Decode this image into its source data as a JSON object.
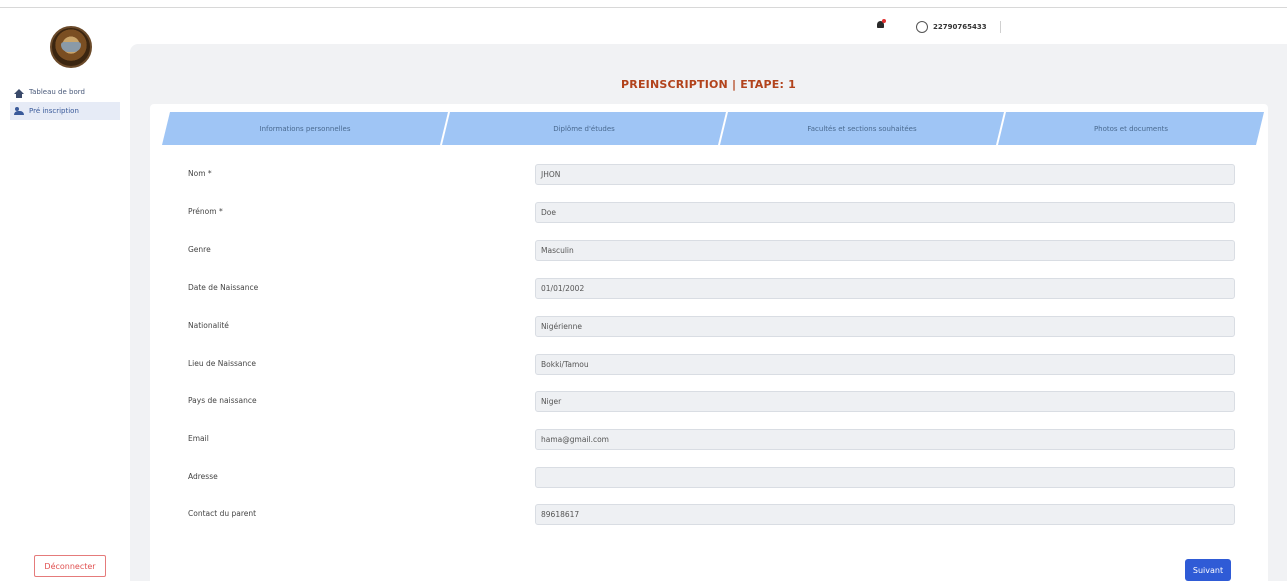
{
  "sidebar": {
    "items": [
      {
        "label": "Tableau de bord",
        "icon": "home-icon"
      },
      {
        "label": "Pré inscription",
        "icon": "users-icon"
      }
    ],
    "logout_label": "Déconnecter"
  },
  "topbar": {
    "user_phone": "22790765433"
  },
  "page": {
    "title": "PREINSCRIPTION | ETAPE: 1"
  },
  "steps": [
    {
      "label": "Informations personnelles"
    },
    {
      "label": "Diplôme d'études"
    },
    {
      "label": "Facultés et sections souhaitées"
    },
    {
      "label": "Photos et documents"
    }
  ],
  "form": {
    "fields": [
      {
        "label": "Nom *",
        "value": "JHON"
      },
      {
        "label": "Prénom *",
        "value": "Doe"
      },
      {
        "label": "Genre",
        "value": "Masculin"
      },
      {
        "label": "Date de Naissance",
        "value": "01/01/2002"
      },
      {
        "label": "Nationalité",
        "value": "Nigérienne"
      },
      {
        "label": "Lieu de Naissance",
        "value": "Bokki/Tamou"
      },
      {
        "label": "Pays de naissance",
        "value": "Niger"
      },
      {
        "label": "Email",
        "value": "hama@gmail.com"
      },
      {
        "label": "Adresse",
        "value": ""
      },
      {
        "label": "Contact du parent",
        "value": "89618617"
      }
    ],
    "next_label": "Suivant"
  },
  "colors": {
    "title": "#b2431c",
    "step_bg": "#9fc5f5",
    "primary_button": "#2f5bd6",
    "logout_border": "#e57b7b"
  }
}
